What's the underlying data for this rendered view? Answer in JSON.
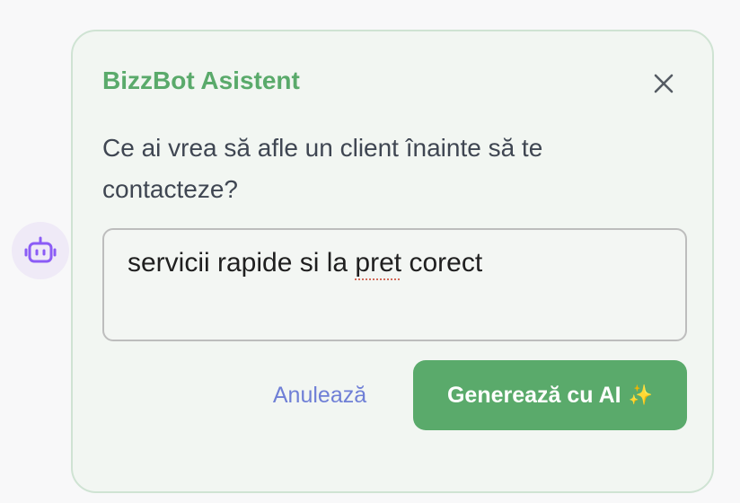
{
  "panel": {
    "title": "BizzBot Asistent",
    "question": "Ce ai vrea să afle un client înainte să te contacteze?",
    "answer": {
      "before": "servicii rapide si la ",
      "misspelled": "pret",
      "after": " corect"
    },
    "cancel_label": "Anulează",
    "generate_label": "Generează cu AI",
    "generate_icon": "✨"
  },
  "icons": {
    "avatar": "robot-icon",
    "close": "close-icon"
  },
  "colors": {
    "accent": "#5aaa6b",
    "link": "#6f7fd6",
    "avatar_bg": "#efeaf7",
    "robot": "#8b5cf6"
  }
}
